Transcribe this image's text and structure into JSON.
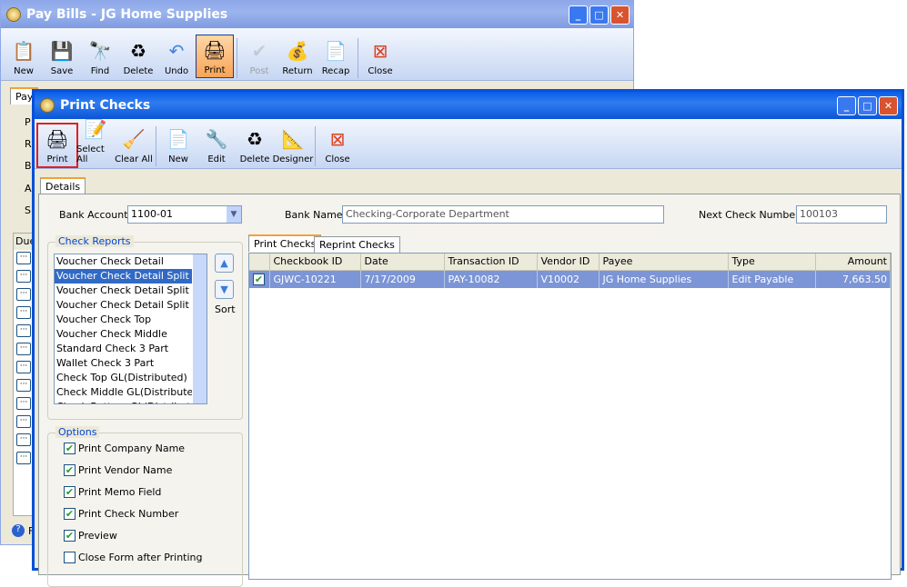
{
  "pay_bills": {
    "title": "Pay Bills - JG Home Supplies",
    "toolbar": [
      "New",
      "Save",
      "Find",
      "Delete",
      "Undo",
      "Print",
      "Post",
      "Return",
      "Recap",
      "Close"
    ],
    "tab": "Pay",
    "side_labels": [
      "P",
      "R",
      "B",
      "A",
      "S"
    ],
    "grid_header": "Due",
    "footer": "F"
  },
  "print_checks": {
    "title": "Print Checks",
    "toolbar": [
      "Print",
      "Select All",
      "Clear All",
      "New",
      "Edit",
      "Delete",
      "Designer",
      "Close"
    ],
    "tab": "Details",
    "bank_account_label": "Bank Account",
    "bank_account": "1100-01",
    "bank_name_label": "Bank Name",
    "bank_name": "Checking-Corporate Department",
    "next_check_label": "Next Check Number",
    "next_check": "100103",
    "check_reports_label": "Check Reports",
    "reports": [
      "Voucher Check Detail",
      "Voucher Check Detail Split",
      "Voucher Check Detail Split Midd",
      "Voucher Check Detail Split Bott",
      "Voucher Check Top",
      "Voucher Check Middle",
      "Standard Check 3 Part",
      "Wallet Check 3 Part",
      "Check Top GL(Distributed)",
      "Check Middle GL(Distributed)",
      "Check Bottom GL(Distributed)"
    ],
    "selected_report": "Voucher Check Detail Split",
    "sort_label": "Sort",
    "options_label": "Options",
    "options": [
      {
        "label": "Print Company Name",
        "checked": true
      },
      {
        "label": "Print Vendor Name",
        "checked": true
      },
      {
        "label": "Print Memo Field",
        "checked": true
      },
      {
        "label": "Print Check Number",
        "checked": true
      },
      {
        "label": "Preview",
        "checked": true
      },
      {
        "label": "Close Form after Printing",
        "checked": false
      }
    ],
    "grid_tabs": [
      "Print Checks",
      "Reprint Checks"
    ],
    "columns": [
      "Checkbook ID",
      "Date",
      "Transaction ID",
      "Vendor ID",
      "Payee",
      "Type",
      "Amount"
    ],
    "rows": [
      {
        "checked": true,
        "cells": [
          "GJWC-10221",
          "7/17/2009",
          "PAY-10082",
          "V10002",
          "JG Home Supplies",
          "Edit Payable",
          "7,663.50"
        ]
      }
    ]
  }
}
